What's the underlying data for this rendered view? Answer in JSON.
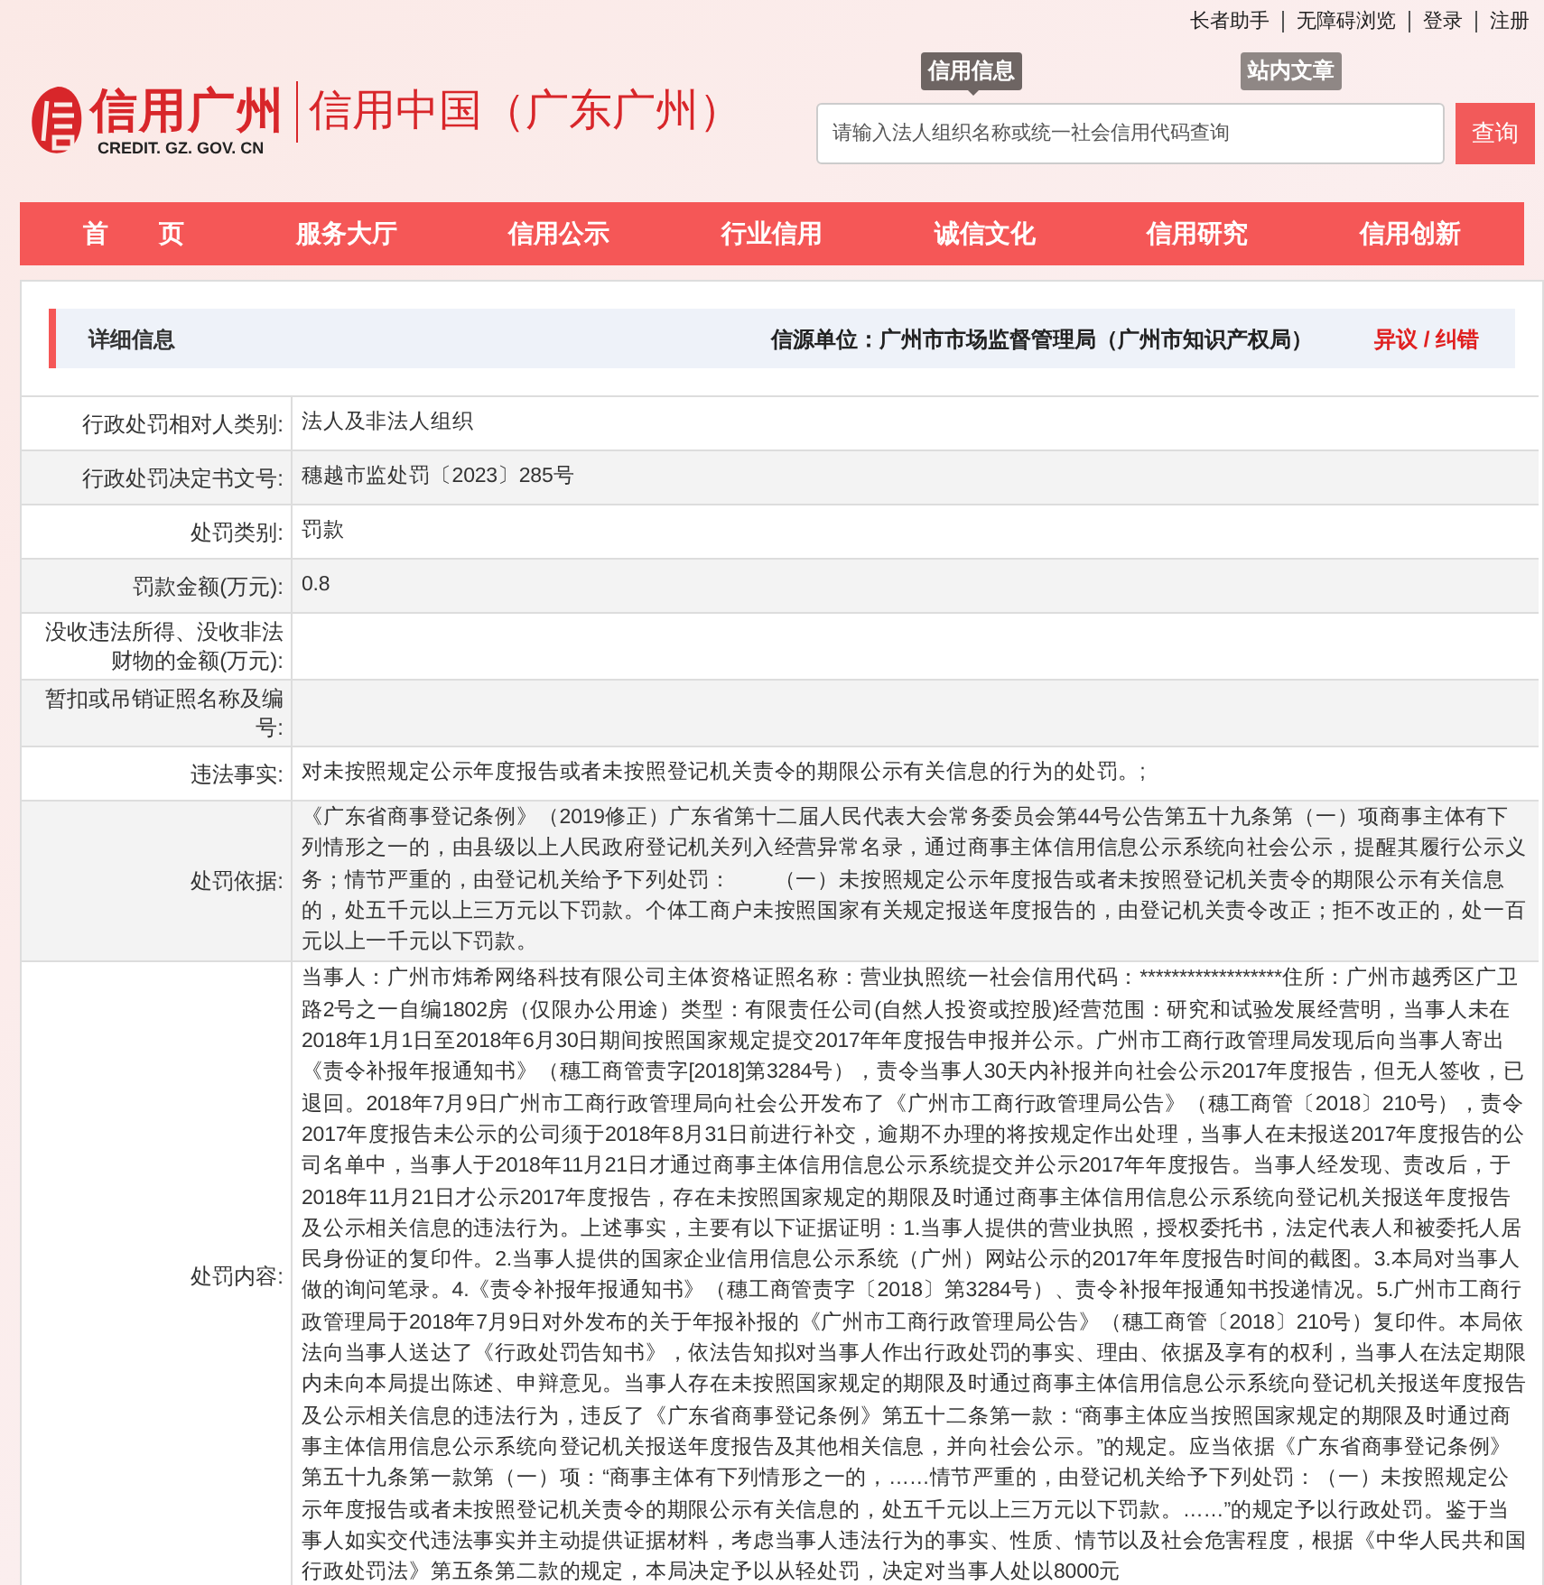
{
  "top_links": [
    "长者助手",
    "无障碍浏览",
    "登录",
    "注册"
  ],
  "logo": {
    "name": "信用广州",
    "domain": "CREDIT. GZ. GOV. CN",
    "subtitle": "信用中国（广东广州）"
  },
  "search": {
    "tabs": [
      {
        "label": "信用信息",
        "selected": true
      },
      {
        "label": "站内文章",
        "selected": false
      }
    ],
    "placeholder": "请输入法人组织名称或统一社会信用代码查询",
    "button": "查询"
  },
  "nav": [
    "首　　页",
    "服务大厅",
    "信用公示",
    "行业信用",
    "诚信文化",
    "信用研究",
    "信用创新"
  ],
  "detail": {
    "title": "详细信息",
    "source": "信源单位：广州市市场监督管理局（广州市知识产权局）",
    "feedback": "异议 / 纠错"
  },
  "rows": [
    {
      "label": "行政处罚相对人类别:",
      "value": "法人及非法人组织"
    },
    {
      "label": "行政处罚决定书文号:",
      "value": "穗越市监处罚〔2023〕285号"
    },
    {
      "label": "处罚类别:",
      "value": "罚款"
    },
    {
      "label": "罚款金额(万元):",
      "value": "0.8"
    },
    {
      "label": "没收违法所得、没收非法财物的金额(万元):"
    },
    {
      "label": "暂扣或吊销证照名称及编号:"
    },
    {
      "label": "违法事实:",
      "value": "对未按照规定公示年度报告或者未按照登记机关责令的期限公示有关信息的行为的处罚。;"
    },
    {
      "label": "处罚依据:",
      "value": "《广东省商事登记条例》（2019修正）广东省第十二届人民代表大会常务委员会第44号公告第五十九条第（一）项商事主体有下列情形之一的，由县级以上人民政府登记机关列入经营异常名录，通过商事主体信用信息公示系统向社会公示，提醒其履行公示义务；情节严重的，由登记机关给予下列处罚：　　（一）未按照规定公示年度报告或者未按照登记机关责令的期限公示有关信息的，处五千元以上三万元以下罚款。个体工商户未按照国家有关规定报送年度报告的，由登记机关责令改正；拒不改正的，处一百元以上一千元以下罚款。"
    },
    {
      "label": "处罚内容:",
      "value": "当事人：广州市炜希网络科技有限公司主体资格证照名称：营业执照统一社会信用代码：******************住所：广州市越秀区广卫路2号之一自编1802房（仅限办公用途）类型：有限责任公司(自然人投资或控股)经营范围：研究和试验发展经营明，当事人未在2018年1月1日至2018年6月30日期间按照国家规定提交2017年年度报告申报并公示。广州市工商行政管理局发现后向当事人寄出《责令补报年报通知书》（穗工商管责字[2018]第3284号），责令当事人30天内补报并向社会公示2017年度报告，但无人签收，已退回。2018年7月9日广州市工商行政管理局向社会公开发布了《广州市工商行政管理局公告》（穗工商管〔2018〕210号），责令2017年度报告未公示的公司须于2018年8月31日前进行补交，逾期不办理的将按规定作出处理，当事人在未报送2017年度报告的公司名单中，当事人于2018年11月21日才通过商事主体信用信息公示系统提交并公示2017年年度报告。当事人经发现、责改后，于2018年11月21日才公示2017年度报告，存在未按照国家规定的期限及时通过商事主体信用信息公示系统向登记机关报送年度报告及公示相关信息的违法行为。上述事实，主要有以下证据证明：1.当事人提供的营业执照，授权委托书，法定代表人和被委托人居民身份证的复印件。2.当事人提供的国家企业信用信息公示系统（广州）网站公示的2017年年度报告时间的截图。3.本局对当事人做的询问笔录。4.《责令补报年报通知书》（穗工商管责字〔2018〕第3284号）、责令补报年报通知书投递情况。5.广州市工商行政管理局于2018年7月9日对外发布的关于年报补报的《广州市工商行政管理局公告》（穗工商管〔2018〕210号）复印件。本局依法向当事人送达了《行政处罚告知书》，依法告知拟对当事人作出行政处罚的事实、理由、依据及享有的权利，当事人在法定期限内未向本局提出陈述、申辩意见。当事人存在未按照国家规定的期限及时通过商事主体信用信息公示系统向登记机关报送年度报告及公示相关信息的违法行为，违反了《广东省商事登记条例》第五十二条第一款：“商事主体应当按照国家规定的期限及时通过商事主体信用信息公示系统向登记机关报送年度报告及其他相关信息，并向社会公示。”的规定。应当依据《广东省商事登记条例》第五十九条第一款第（一）项：“商事主体有下列情形之一的，……情节严重的，由登记机关给予下列处罚：（一）未按照规定公示年度报告或者未按照登记机关责令的期限公示有关信息的，处五千元以上三万元以下罚款。……”的规定予以行政处罚。鉴于当事人如实交代违法事实并主动提供证据材料，考虑当事人违法行为的事实、性质、情节以及社会危害程度，根据《中华人民共和国行政处罚法》第五条第二款的规定，本局决定予以从轻处罚，决定对当事人处以8000元"
    }
  ]
}
